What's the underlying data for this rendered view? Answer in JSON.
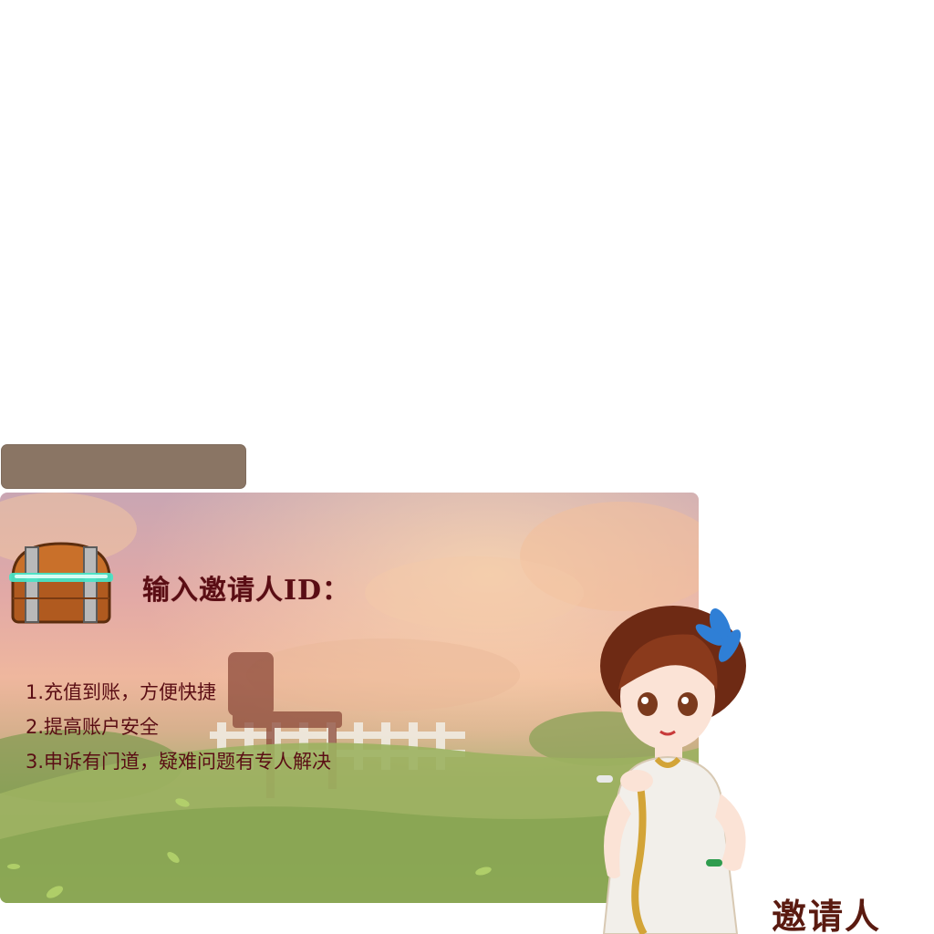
{
  "invite_form": {
    "title": "输入邀请人ID：",
    "id_input_value": "",
    "benefits": [
      "1.充值到账，方便快捷",
      "2.提高账户安全",
      "3.申诉有门道，疑难问题有专人解决"
    ]
  },
  "tab_label": "邀请人",
  "icons": {
    "chest": "treasure-chest-icon",
    "hostess": "hostess-character-illustration"
  },
  "colors": {
    "id_bar": "#8a7564",
    "text_dark_red": "#5a0d14",
    "label_brown": "#5a1a10"
  }
}
